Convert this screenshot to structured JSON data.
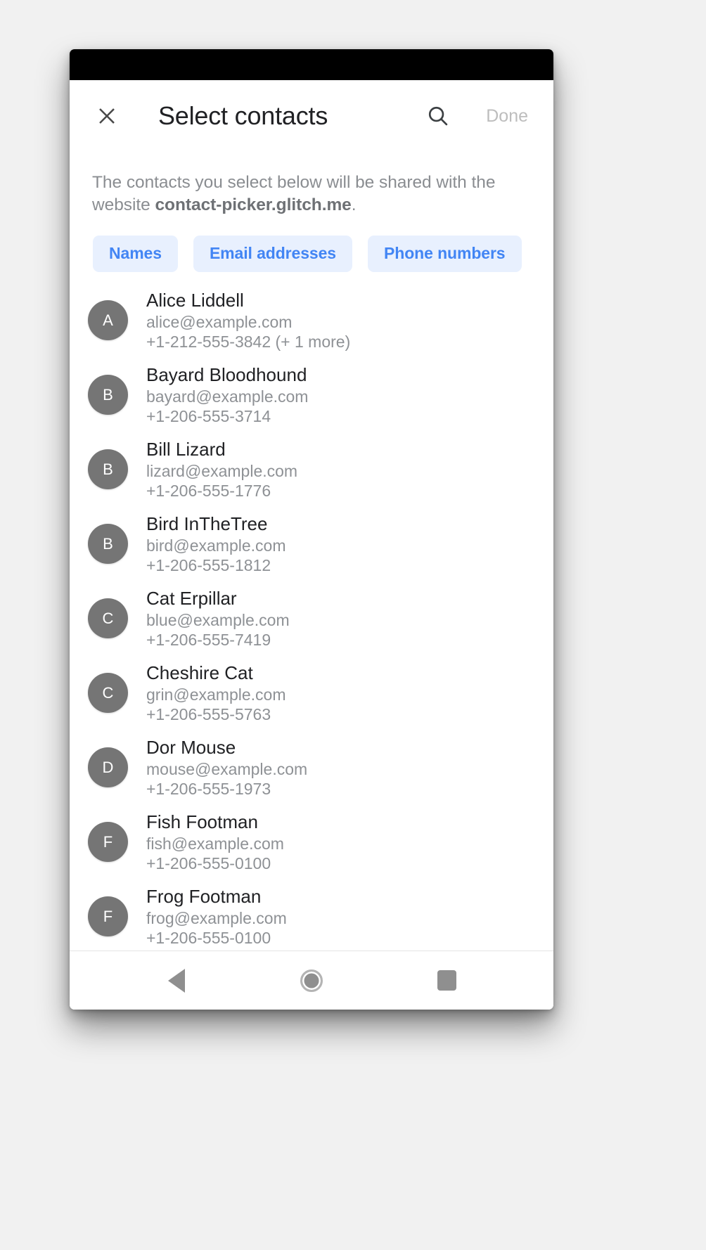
{
  "appbar": {
    "close_icon": "close-icon",
    "title": "Select contacts",
    "search_icon": "search-icon",
    "done_label": "Done",
    "done_color": "#bdbdbd"
  },
  "description": {
    "prefix": "The contacts you select below will be shared with the website ",
    "site": "contact-picker.glitch.me",
    "suffix": "."
  },
  "chips": {
    "accent_text": "#4285f4",
    "accent_bg": "#e8f0fe",
    "items": [
      {
        "label": "Names"
      },
      {
        "label": "Email addresses"
      },
      {
        "label": "Phone numbers"
      }
    ]
  },
  "contacts": {
    "avatar_color": "#757575",
    "items": [
      {
        "initial": "A",
        "name": "Alice Liddell",
        "email": "alice@example.com",
        "phone": "+1-212-555-3842 (+ 1 more)"
      },
      {
        "initial": "B",
        "name": "Bayard Bloodhound",
        "email": "bayard@example.com",
        "phone": "+1-206-555-3714"
      },
      {
        "initial": "B",
        "name": "Bill Lizard",
        "email": "lizard@example.com",
        "phone": "+1-206-555-1776"
      },
      {
        "initial": "B",
        "name": "Bird InTheTree",
        "email": "bird@example.com",
        "phone": "+1-206-555-1812"
      },
      {
        "initial": "C",
        "name": "Cat Erpillar",
        "email": "blue@example.com",
        "phone": "+1-206-555-7419"
      },
      {
        "initial": "C",
        "name": "Cheshire Cat",
        "email": "grin@example.com",
        "phone": "+1-206-555-5763"
      },
      {
        "initial": "D",
        "name": "Dor Mouse",
        "email": "mouse@example.com",
        "phone": "+1-206-555-1973"
      },
      {
        "initial": "F",
        "name": "Fish Footman",
        "email": "fish@example.com",
        "phone": "+1-206-555-0100"
      },
      {
        "initial": "F",
        "name": "Frog Footman",
        "email": "frog@example.com",
        "phone": "+1-206-555-0100"
      }
    ]
  },
  "navbar": {
    "back_icon": "triangle-back-icon",
    "home_icon": "circle-home-icon",
    "recents_icon": "square-recents-icon"
  }
}
